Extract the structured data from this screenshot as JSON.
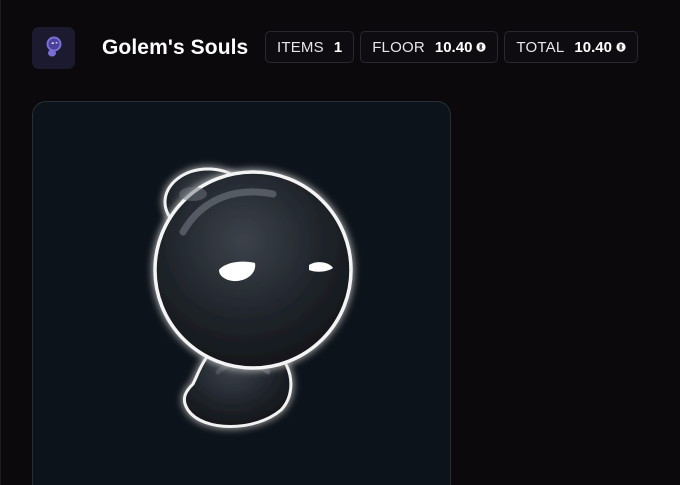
{
  "collection": {
    "name": "Golem's Souls",
    "avatar_icon": "ghost-icon",
    "avatar_color": "#7b6fd6"
  },
  "stats": [
    {
      "label": "ITEMS",
      "value": "1",
      "currency_icon": null
    },
    {
      "label": "FLOOR",
      "value": "10.40",
      "currency_icon": "coin-icon"
    },
    {
      "label": "TOTAL",
      "value": "10.40",
      "currency_icon": "coin-icon"
    }
  ],
  "nft_card": {
    "image_icon": "ghost-soul-icon",
    "background": "#0d131a"
  }
}
